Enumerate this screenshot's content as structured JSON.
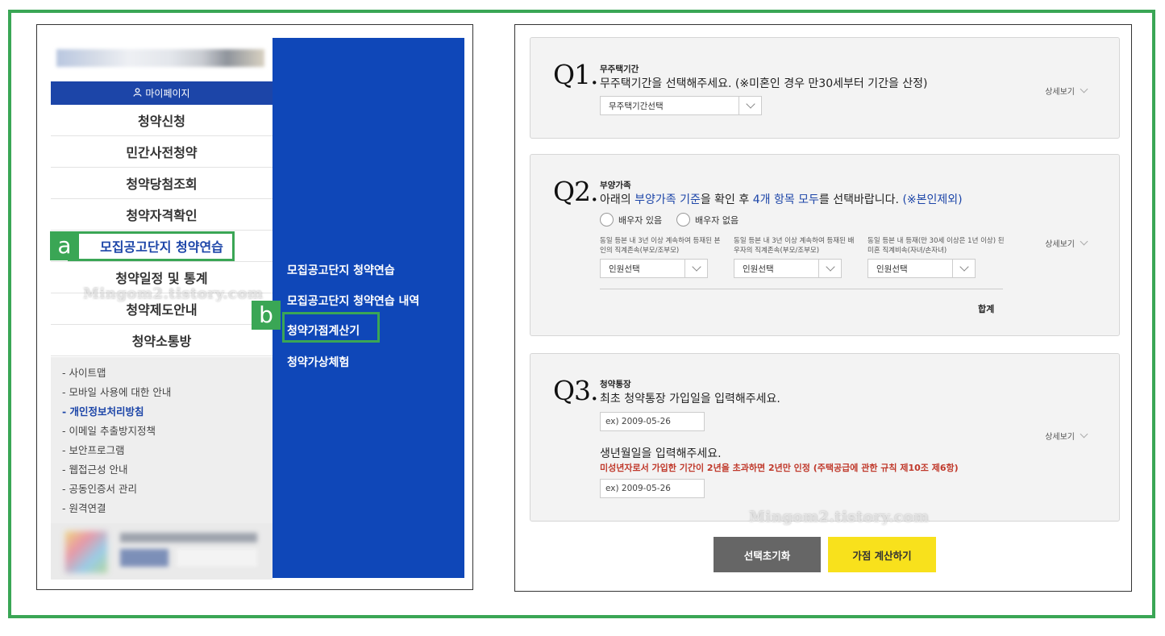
{
  "left": {
    "mypage_label": "마이페이지",
    "menu": [
      {
        "label": "청약신청"
      },
      {
        "label": "민간사전청약"
      },
      {
        "label": "청약당첨조회"
      },
      {
        "label": "청약자격확인"
      },
      {
        "label": "모집공고단지 청약연습"
      },
      {
        "label": "청약일정 및 통계"
      },
      {
        "label": "청약제도안내"
      },
      {
        "label": "청약소통방"
      }
    ],
    "footer_links": [
      "- 사이트맵",
      "- 모바일 사용에 대한 안내",
      "- 개인정보처리방침",
      "- 이메일 추출방지정책",
      "- 보안프로그램",
      "- 웹접근성 안내",
      "- 공동인증서 관리",
      "- 원격연결"
    ],
    "submenu": [
      "모집공고단지 청약연습",
      "모집공고단지 청약연습 내역",
      "청약가점계산기",
      "청약가상체험"
    ],
    "badge_a": "a",
    "badge_b": "b",
    "watermark": "Mingom2.tistory.com"
  },
  "right": {
    "detail_label": "상세보기",
    "q1": {
      "num": "Q1.",
      "title": "무주택기간",
      "desc": "무주택기간을 선택해주세요. (※미혼인 경우 만30세부터 기간을 산정)",
      "select_value": "무주택기간선택"
    },
    "q2": {
      "num": "Q2.",
      "title": "부양가족",
      "desc_1": "아래의 ",
      "desc_2": "부양가족 기준",
      "desc_3": "을 확인 후 ",
      "desc_4": "4개 항목 모두",
      "desc_5": "를 선택바랍니다. ",
      "desc_6": "(※본인제외)",
      "radio_1": "배우자 있음",
      "radio_2": "배우자 없음",
      "cond_1": "동일 등본 내 3년 이상 계속하여 등재된 본인의 직계존속(부모/조부모)",
      "cond_2": "동일 등본 내 3년 이상 계속하여 등재된 배우자의 직계존속(부모/조부모)",
      "cond_3": "동일 등본 내 등재(만 30세 이상은 1년 이상) 된 미혼 직계비속(자녀/손자녀)",
      "select_value": "인원선택",
      "total_label": "합계"
    },
    "q3": {
      "num": "Q3.",
      "title": "청약통장",
      "desc": "최초 청약통장 가입일을 입력해주세요.",
      "date_placeholder": "ex) 2009-05-26",
      "birth_desc": "생년월일을 입력해주세요.",
      "warn": "미성년자로서 가입한 기간이 2년을 초과하면 2년만 인정 ",
      "warn_ref": "(주택공급에 관한 규칙 제10조 제6항)"
    },
    "reset_button": "선택초기화",
    "calc_button": "가점 계산하기",
    "watermark": "Mingom2.tistory.com"
  }
}
